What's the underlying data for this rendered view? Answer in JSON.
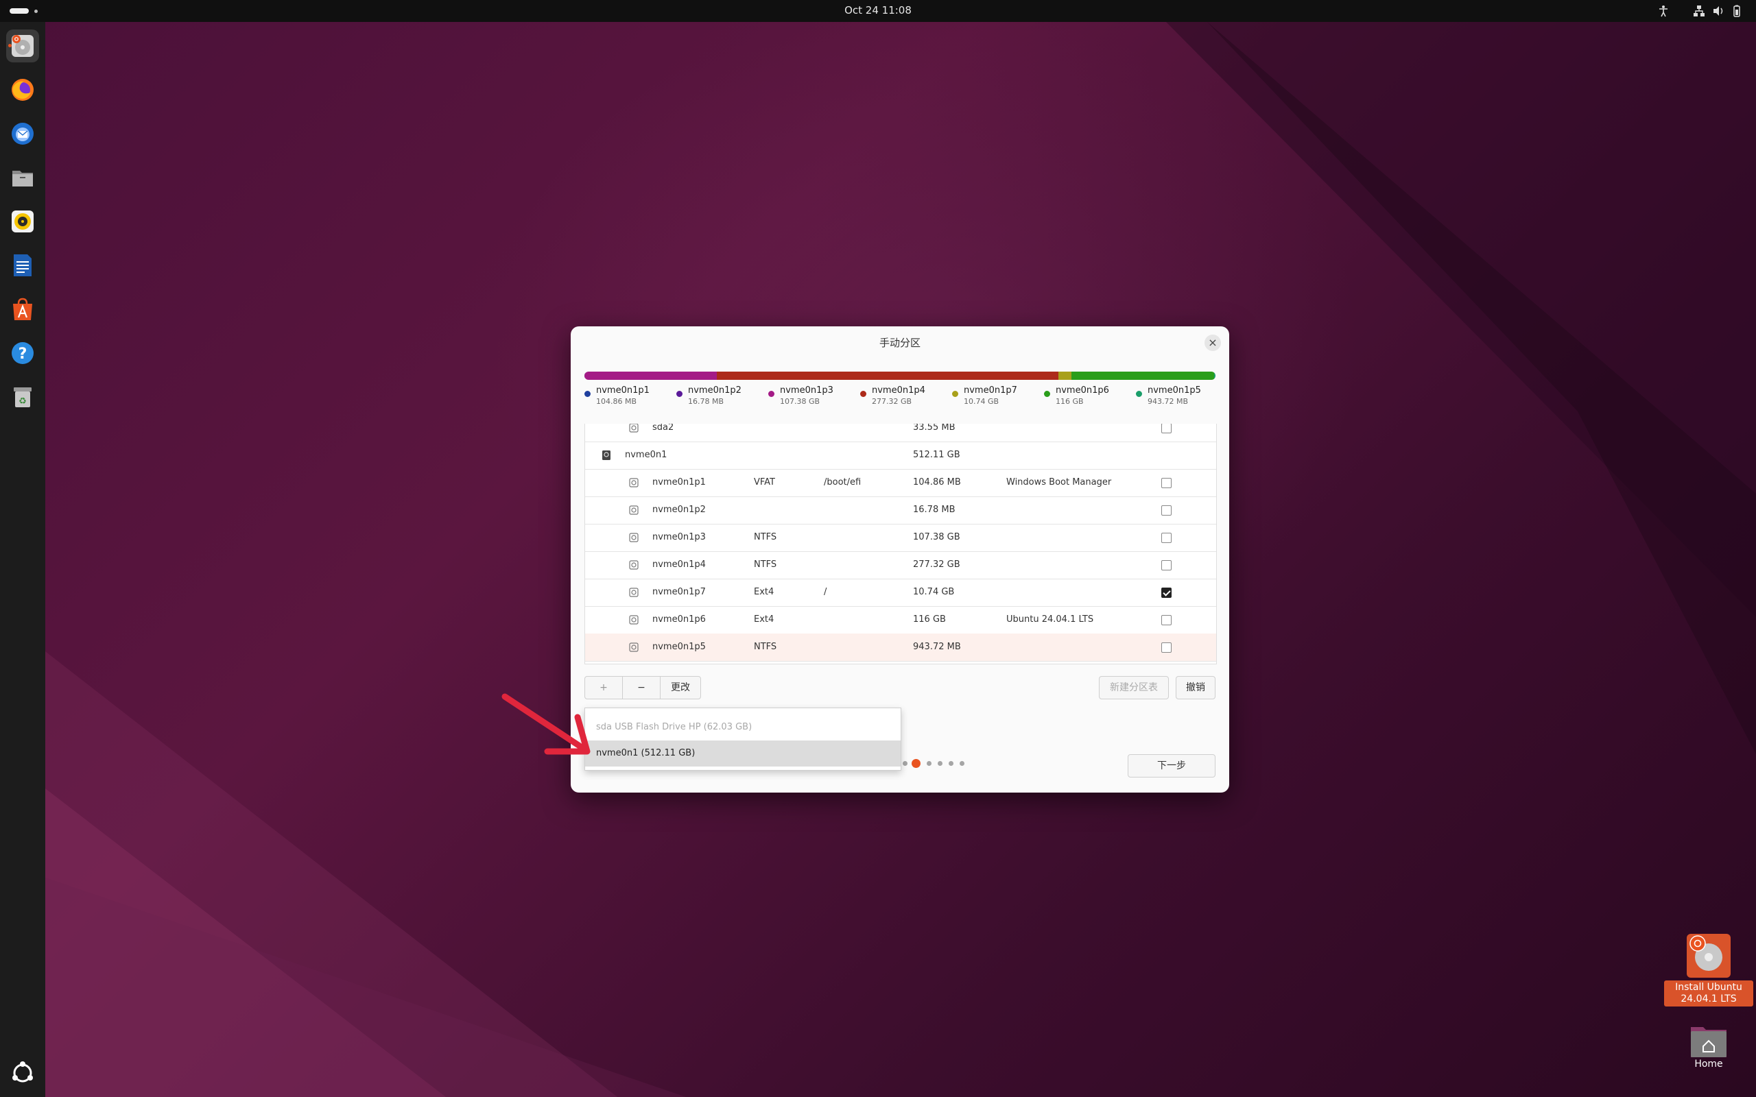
{
  "topbar": {
    "clock": "Oct 24  11:08"
  },
  "dock": {
    "items": [
      {
        "name": "installer",
        "icon": "installer-icon",
        "active": true
      },
      {
        "name": "firefox",
        "icon": "firefox-icon"
      },
      {
        "name": "thunderbird",
        "icon": "thunderbird-icon"
      },
      {
        "name": "files",
        "icon": "files-icon"
      },
      {
        "name": "rhythmbox",
        "icon": "rhythmbox-icon"
      },
      {
        "name": "writer",
        "icon": "writer-icon"
      },
      {
        "name": "app-center",
        "icon": "app-center-icon"
      },
      {
        "name": "help",
        "icon": "help-icon"
      },
      {
        "name": "trash",
        "icon": "trash-icon"
      }
    ]
  },
  "dialog": {
    "title": "手动分区",
    "close": "×",
    "usage_segments": [
      {
        "name": "nvme0n1p1",
        "color": "#1f3f9e",
        "fraction": 0.0002
      },
      {
        "name": "nvme0n1p2",
        "color": "#5a1a99",
        "fraction": 3e-05
      },
      {
        "name": "nvme0n1p3",
        "color": "#a41b86",
        "fraction": 0.2097
      },
      {
        "name": "nvme0n1p4",
        "color": "#ad2a1a",
        "fraction": 0.5415
      },
      {
        "name": "nvme0n1p7",
        "color": "#a8a01a",
        "fraction": 0.021
      },
      {
        "name": "nvme0n1p6",
        "color": "#2a9e1a",
        "fraction": 0.2265
      },
      {
        "name": "nvme0n1p5",
        "color": "#1a9e6a",
        "fraction": 0.0018
      }
    ],
    "legend": [
      {
        "name": "nvme0n1p1",
        "size": "104.86 MB",
        "color": "#1f3f9e"
      },
      {
        "name": "nvme0n1p2",
        "size": "16.78 MB",
        "color": "#5a1a99"
      },
      {
        "name": "nvme0n1p3",
        "size": "107.38 GB",
        "color": "#a41b86"
      },
      {
        "name": "nvme0n1p4",
        "size": "277.32 GB",
        "color": "#ad2a1a"
      },
      {
        "name": "nvme0n1p7",
        "size": "10.74 GB",
        "color": "#a8a01a"
      },
      {
        "name": "nvme0n1p6",
        "size": "116 GB",
        "color": "#2a9e1a"
      },
      {
        "name": "nvme0n1p5",
        "size": "943.72 MB",
        "color": "#1a9e6a"
      }
    ],
    "rows": [
      {
        "kind": "part",
        "device": "sda2",
        "type": "",
        "mount": "",
        "size": "33.55 MB",
        "system": "",
        "format": false
      },
      {
        "kind": "disk",
        "device": "nvme0n1",
        "type": "",
        "mount": "",
        "size": "512.11 GB",
        "system": ""
      },
      {
        "kind": "part",
        "device": "nvme0n1p1",
        "type": "VFAT",
        "mount": "/boot/efi",
        "size": "104.86 MB",
        "system": "Windows Boot Manager",
        "format": false
      },
      {
        "kind": "part",
        "device": "nvme0n1p2",
        "type": "",
        "mount": "",
        "size": "16.78 MB",
        "system": "",
        "format": false
      },
      {
        "kind": "part",
        "device": "nvme0n1p3",
        "type": "NTFS",
        "mount": "",
        "size": "107.38 GB",
        "system": "",
        "format": false
      },
      {
        "kind": "part",
        "device": "nvme0n1p4",
        "type": "NTFS",
        "mount": "",
        "size": "277.32 GB",
        "system": "",
        "format": false
      },
      {
        "kind": "part",
        "device": "nvme0n1p7",
        "type": "Ext4",
        "mount": "/",
        "size": "10.74 GB",
        "system": "",
        "format": true
      },
      {
        "kind": "part",
        "device": "nvme0n1p6",
        "type": "Ext4",
        "mount": "",
        "size": "116 GB",
        "system": "Ubuntu 24.04.1 LTS",
        "format": false
      },
      {
        "kind": "part",
        "device": "nvme0n1p5",
        "type": "NTFS",
        "mount": "",
        "size": "943.72 MB",
        "system": "",
        "format": false,
        "selected": true
      }
    ],
    "buttons": {
      "add": "+",
      "remove": "−",
      "change": "更改",
      "new_table": "新建分区表",
      "revert": "撤销",
      "next": "下一步"
    },
    "boot_device_dropdown": {
      "options": [
        {
          "label": "sda USB Flash Drive HP (62.03 GB)",
          "disabled": true
        },
        {
          "label": "nvme0n1  (512.11 GB)",
          "active": true
        }
      ]
    },
    "pager": {
      "total": 7,
      "current": 2
    }
  },
  "desktop": {
    "install": {
      "label_line1": "Install Ubuntu",
      "label_line2": "24.04.1 LTS"
    },
    "home": {
      "label": "Home"
    }
  }
}
